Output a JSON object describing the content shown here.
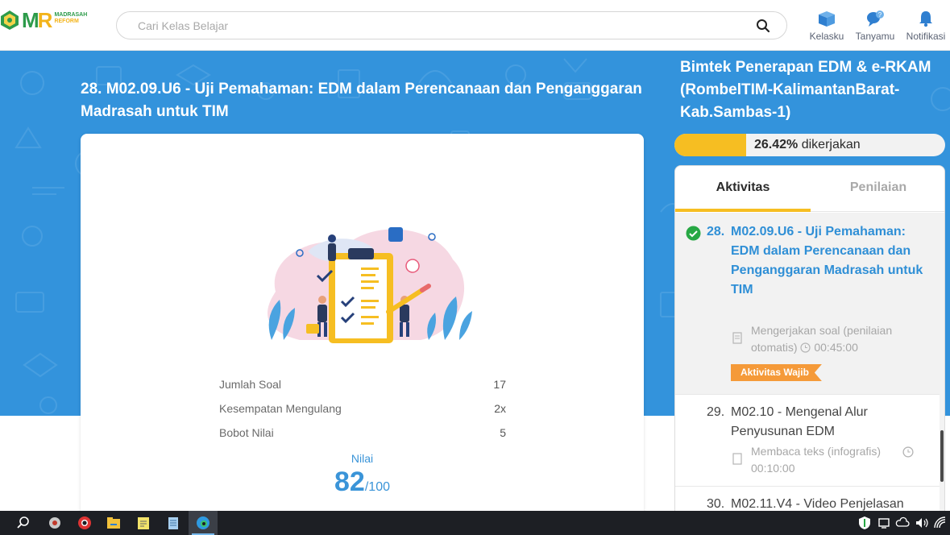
{
  "header": {
    "logo_alt": "Madrasah Reform",
    "logo_line1": "MADRASAH",
    "logo_line2": "REFORM",
    "search_placeholder": "Cari Kelas Belajar",
    "nav": [
      {
        "label": "Kelasku",
        "icon": "book-stack-icon"
      },
      {
        "label": "Tanyamu",
        "icon": "question-bubble-icon"
      },
      {
        "label": "Notifikasi",
        "icon": "bell-icon"
      }
    ]
  },
  "activity": {
    "title": "28. M02.09.U6 - Uji Pemahaman: EDM dalam Perencanaan dan Penganggaran Madrasah untuk TIM",
    "stats": [
      {
        "label": "Jumlah Soal",
        "value": "17"
      },
      {
        "label": "Kesempatan Mengulang",
        "value": "2x"
      },
      {
        "label": "Bobot Nilai",
        "value": "5"
      }
    ],
    "score_label": "Nilai",
    "score": "82",
    "score_max": "/100"
  },
  "course": {
    "title": "Bimtek Penerapan EDM & e-RKAM (RombelTIM-KalimantanBarat-Kab.Sambas-1)",
    "progress_percent": 26.42,
    "progress_value": "26.42%",
    "progress_suffix": " dikerjakan"
  },
  "panel": {
    "tabs": [
      "Aktivitas",
      "Penilaian"
    ],
    "active_tab": "Aktivitas",
    "items": [
      {
        "num": "28.",
        "title": "M02.09.U6 - Uji Pemahaman: EDM dalam Perencanaan dan Penganggaran Madrasah untuk TIM",
        "meta": "Mengerjakan soal (penilaian otomatis)",
        "duration": "00:45:00",
        "badge": "Aktivitas Wajib",
        "completed": true
      },
      {
        "num": "29.",
        "title": "M02.10 - Mengenal Alur Penyusunan EDM",
        "meta": "Membaca teks (infografis)",
        "duration": "00:10:00"
      },
      {
        "num": "30.",
        "title": "M02.11.V4 - Video Penjelasan"
      }
    ]
  },
  "colors": {
    "hero": "#3393dc",
    "accent_yellow": "#f6be22",
    "link_blue": "#2f8fd6",
    "badge_orange": "#f59a39",
    "success_green": "#27a844"
  },
  "taskbar": {
    "icons": [
      "search-icon",
      "app-icon",
      "chrome-icon",
      "file-explorer-icon",
      "notes-icon",
      "notepad-icon",
      "edge-icon"
    ],
    "tray": [
      "shield-icon",
      "network-icon",
      "volume-icon",
      "wifi-icon"
    ]
  }
}
